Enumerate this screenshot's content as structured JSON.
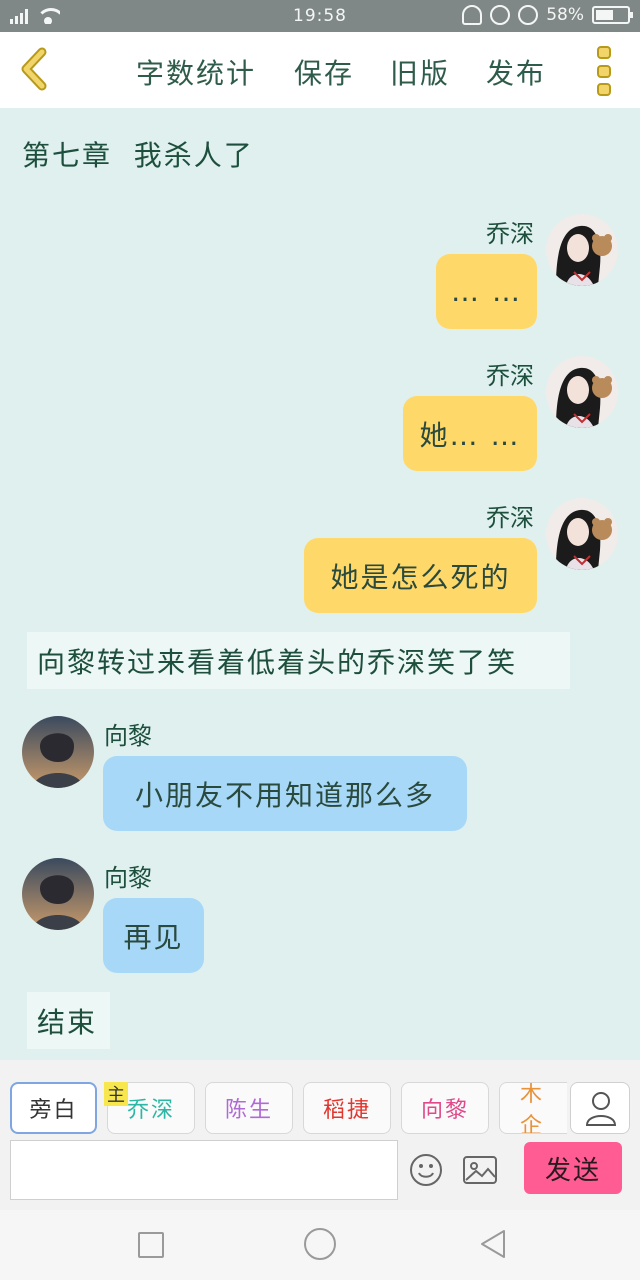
{
  "status_bar": {
    "time": "19:58",
    "battery": "58%",
    "battery_level": 0.58,
    "signal_icon": "signal-bars-icon",
    "wifi_icon": "wifi-icon"
  },
  "header": {
    "back_icon": "chevron-left-icon",
    "menu": [
      "字数统计",
      "保存",
      "旧版",
      "发布"
    ],
    "more_icon": "vertical-dots-icon",
    "accent": "#f2d56a"
  },
  "chat": {
    "chapter_title": "第七章  我杀人了",
    "messages": [
      {
        "type": "right",
        "speaker": "乔深",
        "text": "… …"
      },
      {
        "type": "right",
        "speaker": "乔深",
        "text": "她… …"
      },
      {
        "type": "right",
        "speaker": "乔深",
        "text": "她是怎么死的"
      },
      {
        "type": "narration",
        "text": "向黎转过来看着低着头的乔深笑了笑"
      },
      {
        "type": "left",
        "speaker": "向黎",
        "text": "小朋友不用知道那么多"
      },
      {
        "type": "left",
        "speaker": "向黎",
        "text": "再见"
      },
      {
        "type": "narration",
        "text": "结束"
      }
    ],
    "colors": {
      "right_bubble": "#ffd86a",
      "left_bubble": "#a8d8f8",
      "background": "#dff0ef"
    }
  },
  "composer": {
    "roles": [
      {
        "label": "旁白",
        "color": "#333333"
      },
      {
        "label": "乔深",
        "color": "#2bb7a3"
      },
      {
        "label": "陈生",
        "color": "#b06ad6"
      },
      {
        "label": "稻捷",
        "color": "#e0372f"
      },
      {
        "label": "向黎",
        "color": "#e04a8a"
      },
      {
        "label": "木企",
        "color": "#e8933a"
      }
    ],
    "main_badge": "主",
    "input_value": "",
    "send_label": "发送",
    "send_color": "#ff5c93"
  }
}
